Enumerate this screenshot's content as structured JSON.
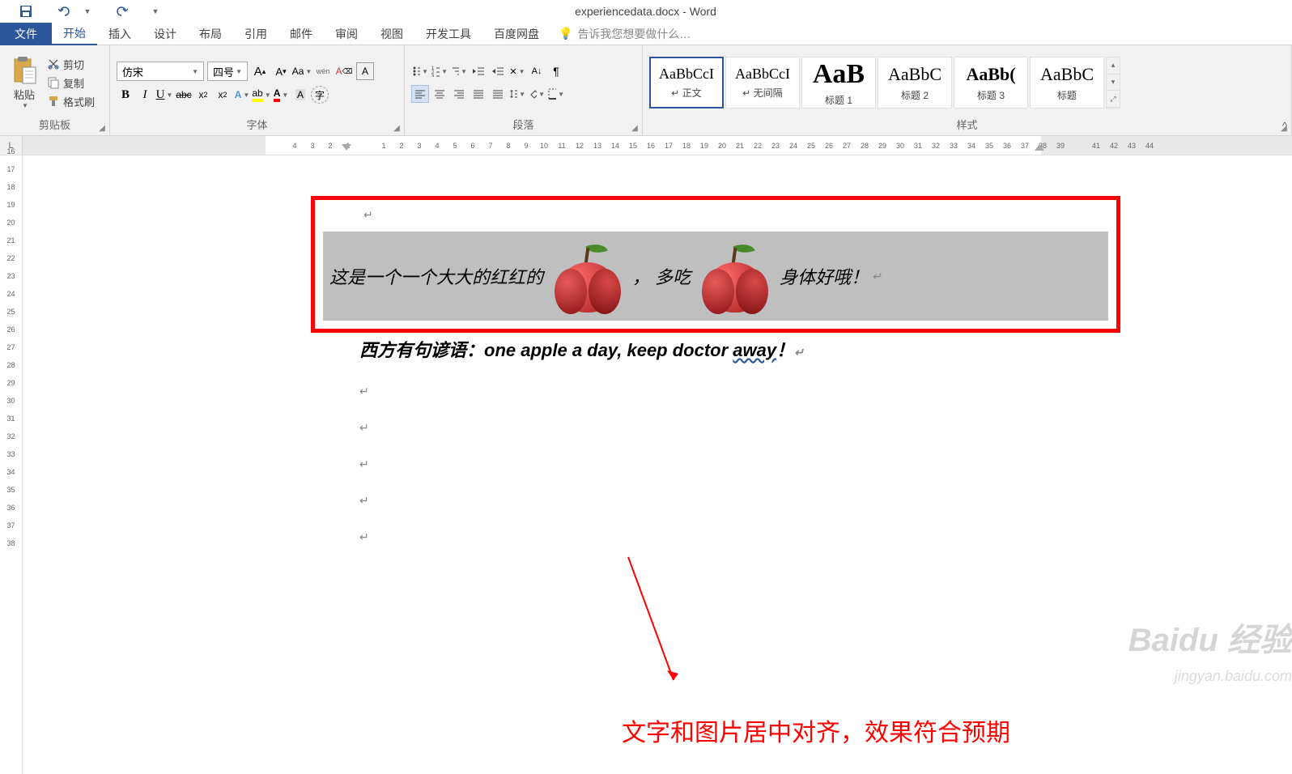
{
  "title": "experiencedata.docx - Word",
  "tabs": {
    "file": "文件",
    "list": [
      "开始",
      "插入",
      "设计",
      "布局",
      "引用",
      "邮件",
      "审阅",
      "视图",
      "开发工具",
      "百度网盘"
    ],
    "active": "开始",
    "tell_me": "告诉我您想要做什么…"
  },
  "clipboard": {
    "paste": "粘贴",
    "cut": "剪切",
    "copy": "复制",
    "format_painter": "格式刷",
    "group": "剪贴板"
  },
  "font": {
    "name": "仿宋",
    "size": "四号",
    "group": "字体"
  },
  "paragraph": {
    "group": "段落"
  },
  "styles": {
    "group": "样式",
    "items": [
      {
        "preview": "AaBbCcI",
        "name": "↵ 正文",
        "size": "18px",
        "bold": false
      },
      {
        "preview": "AaBbCcI",
        "name": "↵ 无间隔",
        "size": "18px",
        "bold": false
      },
      {
        "preview": "AaB",
        "name": "标题 1",
        "size": "34px",
        "bold": true
      },
      {
        "preview": "AaBbC",
        "name": "标题 2",
        "size": "22px",
        "bold": false
      },
      {
        "preview": "AaBb(",
        "name": "标题 3",
        "size": "22px",
        "bold": true
      },
      {
        "preview": "AaBbC",
        "name": "标题",
        "size": "22px",
        "bold": false
      }
    ]
  },
  "document": {
    "line1_a": "这是一个一个大大的红红的",
    "line1_b": "， 多吃",
    "line1_c": "身体好哦！",
    "line2_a": "西方有句谚语：",
    "line2_b": "one apple a day, keep doctor ",
    "line2_c": "away",
    "line2_d": "！"
  },
  "annotation": "文字和图片居中对齐，效果符合预期",
  "watermark": {
    "main": "Baidu 经验",
    "sub": "jingyan.baidu.com"
  },
  "ruler_h": [
    "4",
    "3",
    "2",
    "1",
    "",
    "1",
    "2",
    "3",
    "4",
    "5",
    "6",
    "7",
    "8",
    "9",
    "10",
    "11",
    "12",
    "13",
    "14",
    "15",
    "16",
    "17",
    "18",
    "19",
    "20",
    "21",
    "22",
    "23",
    "24",
    "25",
    "26",
    "27",
    "28",
    "29",
    "30",
    "31",
    "32",
    "33",
    "34",
    "35",
    "36",
    "37",
    "38",
    "39",
    "",
    "41",
    "42",
    "43",
    "44"
  ],
  "ruler_v": [
    "16",
    "17",
    "18",
    "19",
    "20",
    "21",
    "22",
    "23",
    "24",
    "25",
    "26",
    "27",
    "28",
    "29",
    "30",
    "31",
    "32",
    "33",
    "34",
    "35",
    "36",
    "37",
    "38"
  ]
}
